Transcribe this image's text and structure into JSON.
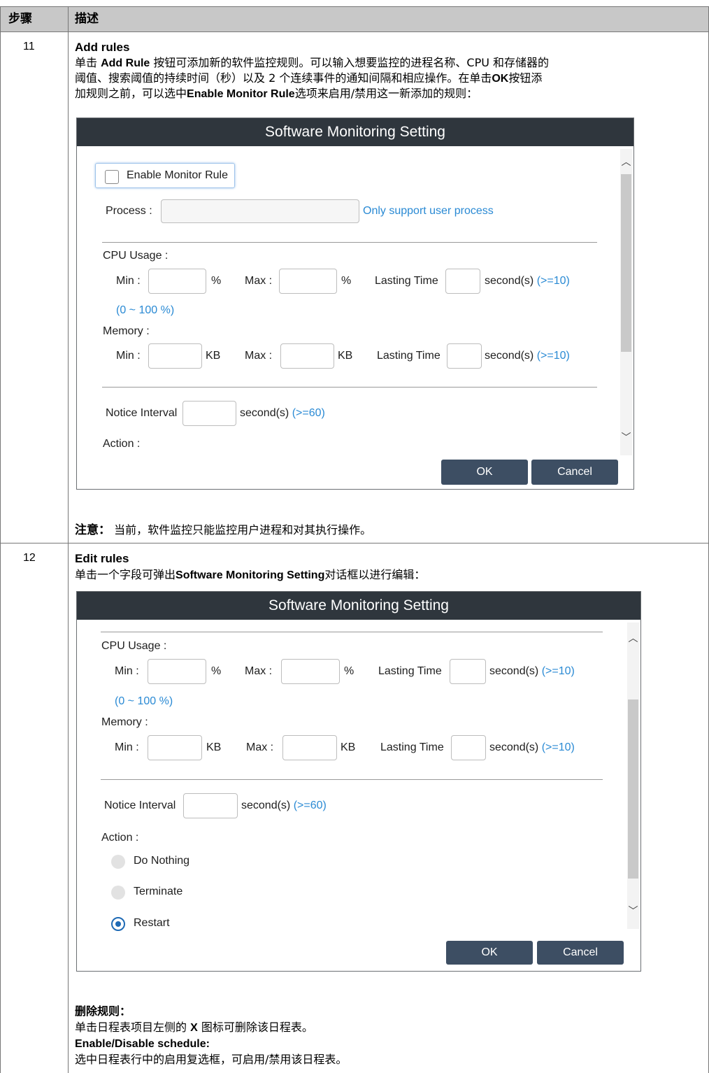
{
  "table": {
    "header_step": "步骤",
    "header_desc": "描述"
  },
  "row11": {
    "step": "11",
    "title": "Add rules",
    "line1_pre": "单击 ",
    "line1_bold": "Add Rule",
    "line1_post": " 按钮可添加新的软件监控规则。可以输入想要监控的进程名称、CPU 和存储器的",
    "line2": "阈值、搜索阈值的持续时间（秒）以及 2 个连续事件的通知间隔和相应操作。在单击",
    "line2_bold": "OK",
    "line2_post": "按钮添",
    "line3_pre": "加规则之前，可以选中",
    "line3_bold": "Enable Monitor Rule",
    "line3_post": "选项来启用/禁用这一新添加的规则：",
    "note_label": "注意：",
    "note_text": "当前，软件监控只能监控用户进程和对其执行操作。"
  },
  "dialog1": {
    "title": "Software Monitoring Setting",
    "enable_label": "Enable Monitor Rule",
    "enable_checked": false,
    "process_label": "Process :",
    "process_value": "",
    "process_hint": "Only support user process",
    "cpu_label": "CPU Usage :",
    "min_label": "Min :",
    "max_label": "Max :",
    "pct": "%",
    "lasting_label": "Lasting Time",
    "seconds": "second(s)",
    "ge10": "(>=10)",
    "cpu_range": "(0 ~ 100 %)",
    "memory_label": "Memory :",
    "kb": "KB",
    "notice_label": "Notice Interval",
    "ge60": "(>=60)",
    "action_label": "Action :",
    "ok": "OK",
    "cancel": "Cancel"
  },
  "row12": {
    "step": "12",
    "title": "Edit rules",
    "line1_pre": "单击一个字段可弹出",
    "line1_bold": "Software Monitoring Setting",
    "line1_post": "对话框以进行编辑：",
    "delete_title": "删除规则：",
    "delete_text_pre": "单击日程表项目左侧的 ",
    "delete_text_bold": "X",
    "delete_text_post": " 图标可删除该日程表。",
    "enable_title": "Enable/Disable schedule:",
    "enable_text": "选中日程表行中的启用复选框，可启用/禁用该日程表。"
  },
  "dialog2": {
    "title": "Software Monitoring Setting",
    "cpu_label": "CPU Usage :",
    "min_label": "Min :",
    "max_label": "Max :",
    "pct": "%",
    "lasting_label": "Lasting Time",
    "seconds": "second(s)",
    "ge10": "(>=10)",
    "cpu_range": "(0 ~ 100 %)",
    "memory_label": "Memory :",
    "kb": "KB",
    "notice_label": "Notice Interval",
    "ge60": "(>=60)",
    "action_label": "Action :",
    "actions": [
      "Do Nothing",
      "Terminate",
      "Restart"
    ],
    "selected_action": "Restart",
    "ok": "OK",
    "cancel": "Cancel"
  }
}
